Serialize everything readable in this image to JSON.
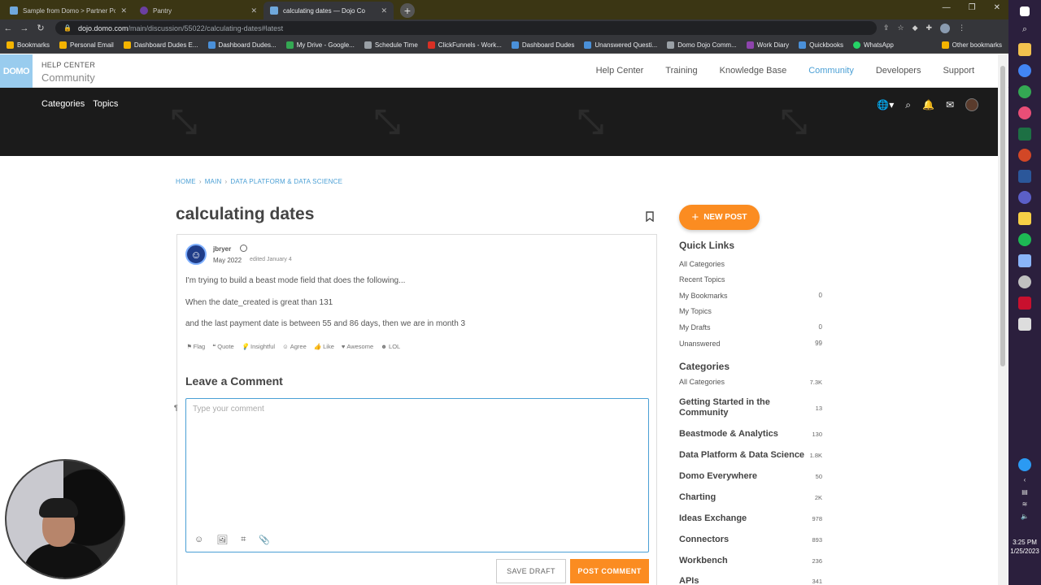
{
  "browser": {
    "tabs": [
      {
        "title": "Sample from Domo > Partner Po",
        "active": false
      },
      {
        "title": "Pantry",
        "active": false
      },
      {
        "title": "calculating dates — Dojo Co",
        "active": true
      }
    ],
    "url_host": "dojo.domo.com",
    "url_path": "/main/discussion/55022/calculating-dates#latest",
    "bookmarks": [
      "Bookmarks",
      "Personal Email",
      "Dashboard Dudes E...",
      "Dashboard Dudes...",
      "My Drive - Google...",
      "Schedule Time",
      "ClickFunnels - Work...",
      "Dashboard Dudes",
      "Unanswered Questi...",
      "Domo Dojo Comm...",
      "Work Diary",
      "Quickbooks",
      "WhatsApp"
    ],
    "other_bookmarks": "Other bookmarks"
  },
  "header": {
    "logo": "DOMO",
    "brand_top": "HELP CENTER",
    "brand_bottom": "Community",
    "nav": [
      {
        "label": "Help Center"
      },
      {
        "label": "Training"
      },
      {
        "label": "Knowledge Base"
      },
      {
        "label": "Community",
        "active": true
      },
      {
        "label": "Developers"
      },
      {
        "label": "Support"
      }
    ]
  },
  "subnav": {
    "categories": "Categories",
    "topics": "Topics"
  },
  "breadcrumb": {
    "home": "HOME",
    "main": "MAIN",
    "section": "DATA PLATFORM & DATA SCIENCE",
    "sep": "›"
  },
  "post": {
    "title": "calculating dates",
    "author": "jbryer",
    "date": "May 2022",
    "edited": "edited January 4",
    "lines": [
      "I'm trying to build a beast mode field that does the following...",
      "When the date_created is great than 131",
      "and the last payment date is between 55 and 86 days, then we are in month 3"
    ],
    "reactions": [
      "Flag",
      "Quote",
      "Insightful",
      "Agree",
      "Like",
      "Awesome",
      "LOL"
    ]
  },
  "comment": {
    "heading": "Leave a Comment",
    "placeholder": "Type your comment",
    "save_draft": "SAVE DRAFT",
    "post_comment": "POST COMMENT"
  },
  "sidebar": {
    "new_post": "NEW POST",
    "quick_links_title": "Quick Links",
    "quick_links": [
      {
        "label": "All Categories",
        "count": ""
      },
      {
        "label": "Recent Topics",
        "count": ""
      },
      {
        "label": "My Bookmarks",
        "count": "0"
      },
      {
        "label": "My Topics",
        "count": ""
      },
      {
        "label": "My Drafts",
        "count": "0"
      },
      {
        "label": "Unanswered",
        "count": "99"
      }
    ],
    "categories_title": "Categories",
    "all_categories": {
      "label": "All Categories",
      "count": "7.3K"
    },
    "categories": [
      {
        "label": "Getting Started in the Community",
        "count": "13"
      },
      {
        "label": "Beastmode & Analytics",
        "count": "130"
      },
      {
        "label": "Data Platform & Data Science",
        "count": "1.8K"
      },
      {
        "label": "Domo Everywhere",
        "count": "50"
      },
      {
        "label": "Charting",
        "count": "2K"
      },
      {
        "label": "Ideas Exchange",
        "count": "978"
      },
      {
        "label": "Connectors",
        "count": "893"
      },
      {
        "label": "Workbench",
        "count": "236"
      },
      {
        "label": "APIs",
        "count": "341"
      }
    ]
  },
  "taskbar": {
    "time": "3:25 PM",
    "date": "1/25/2023"
  },
  "colors": {
    "accent": "#4a9fd5",
    "orange": "#fb8c21",
    "banner": "#1b1b1b"
  }
}
